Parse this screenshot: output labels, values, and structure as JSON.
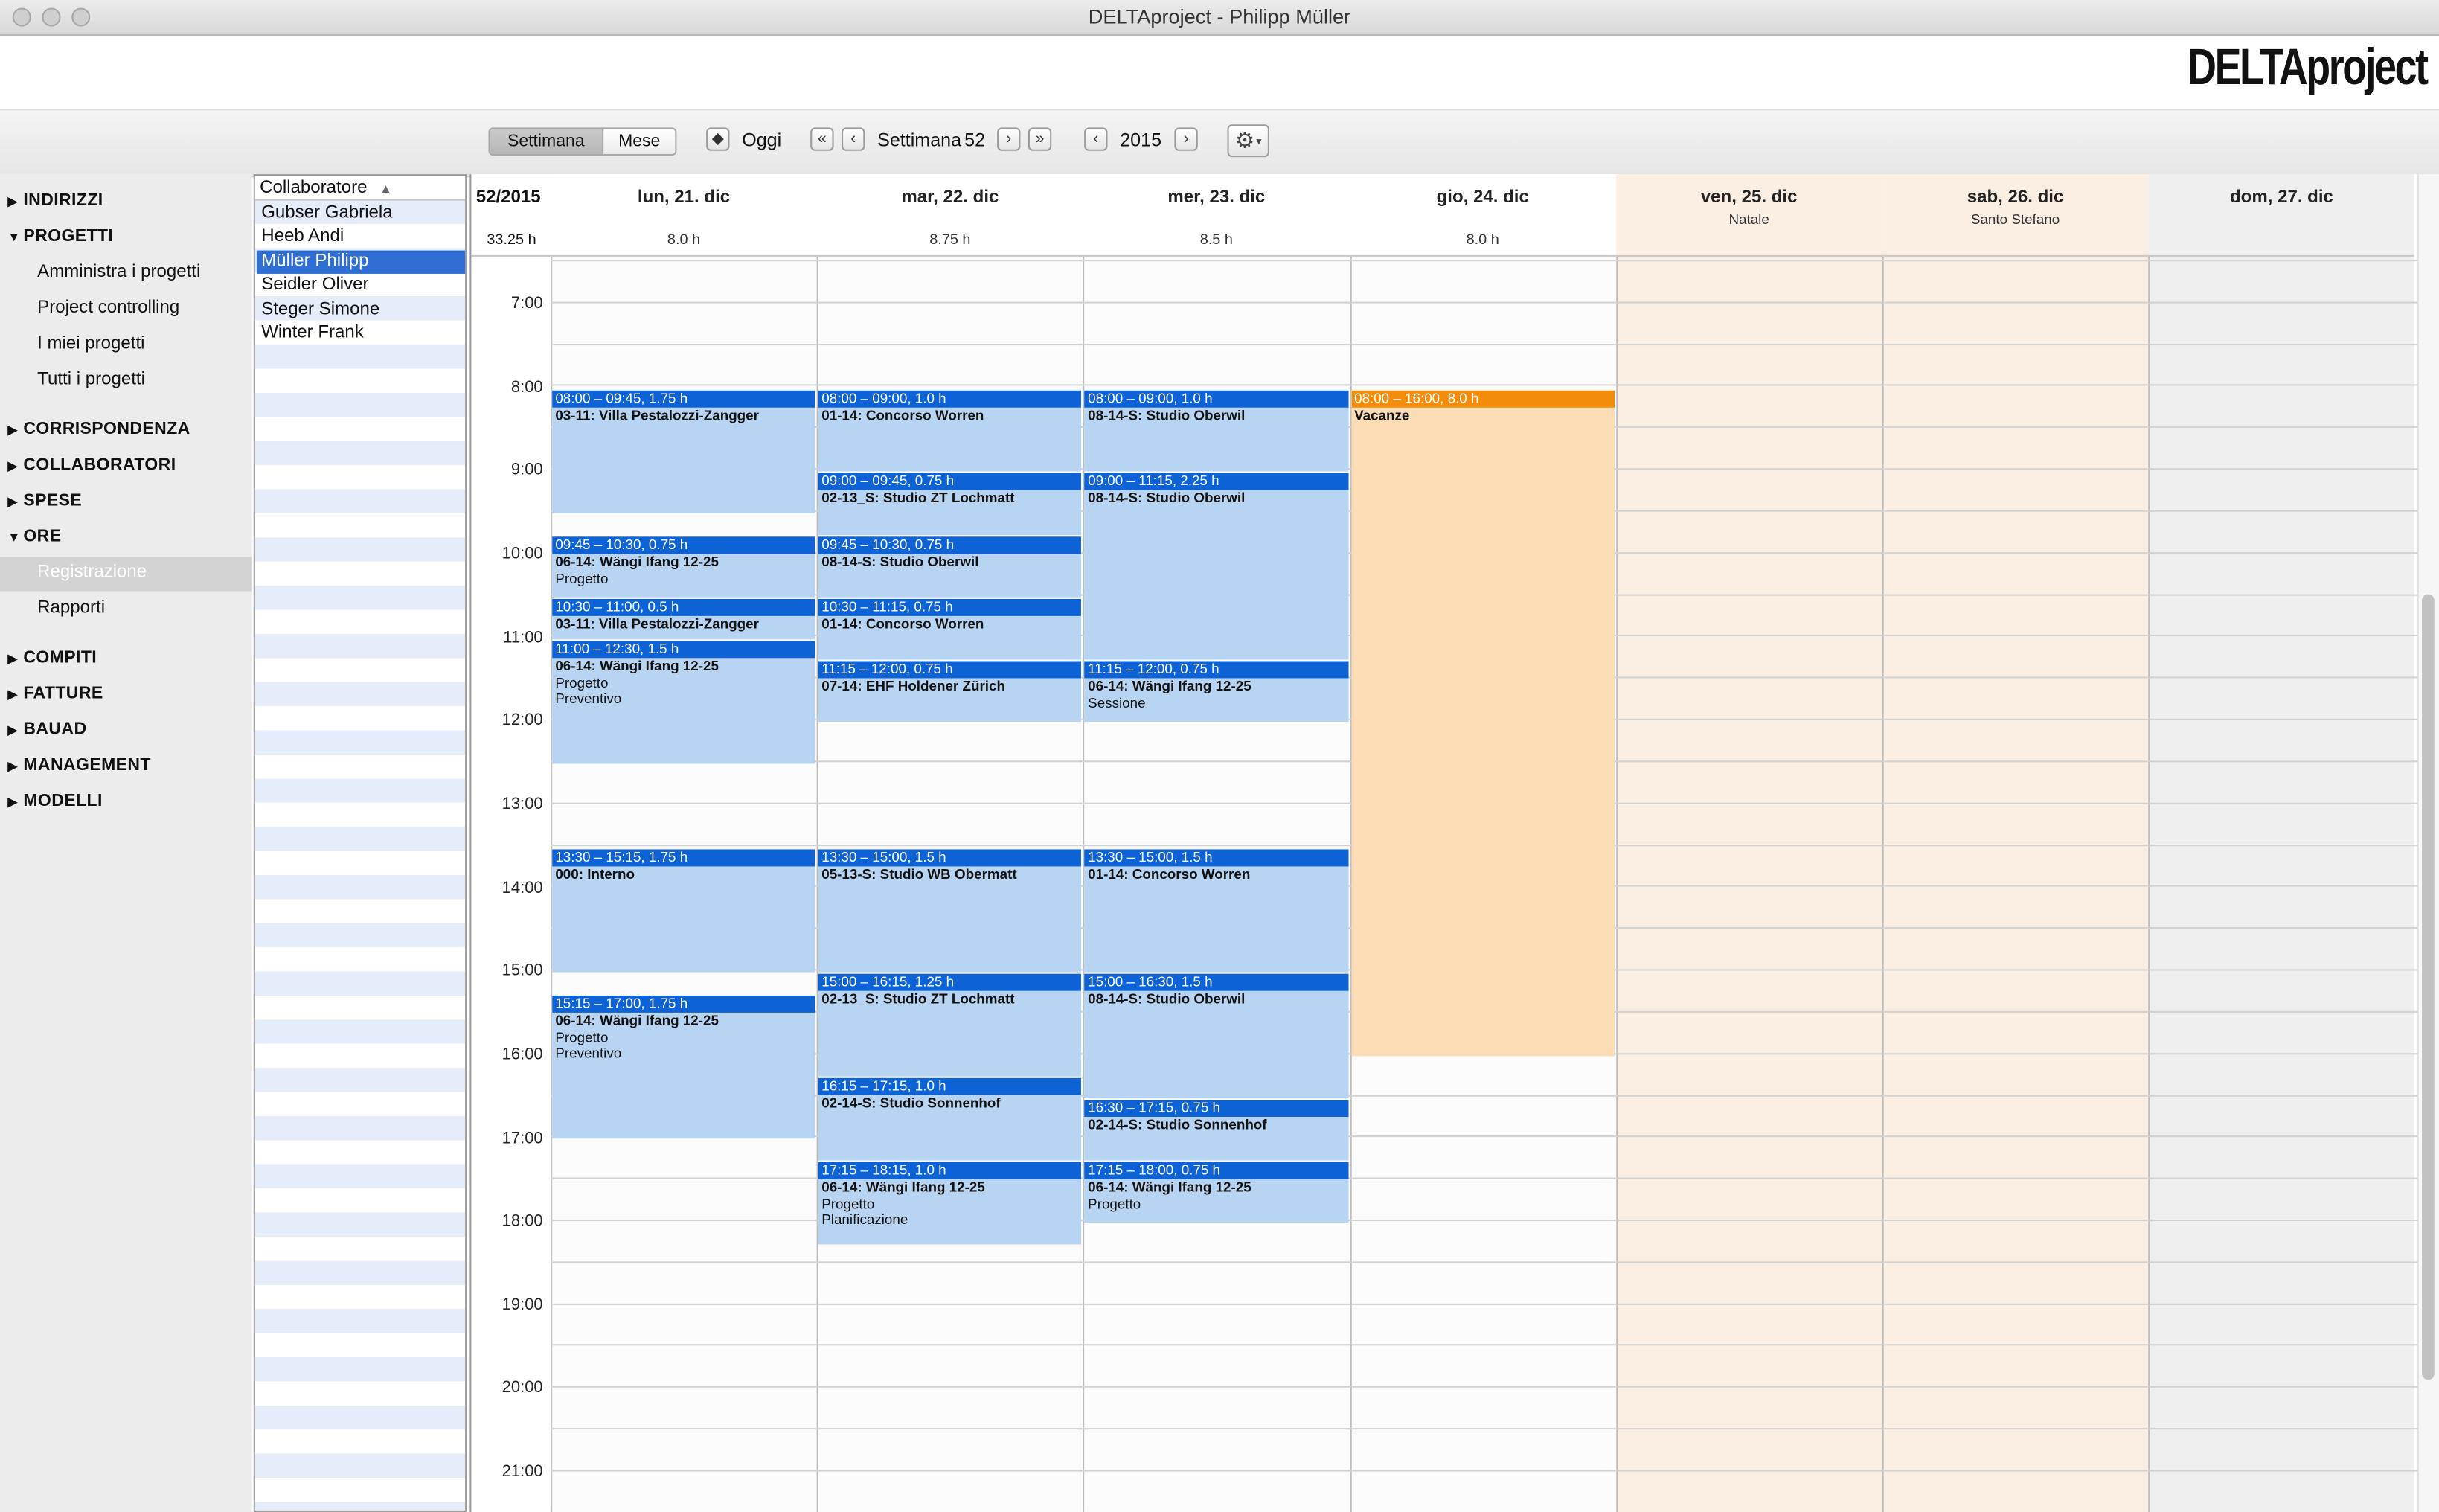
{
  "window": {
    "title": "DELTAproject - Philipp Müller"
  },
  "brand": {
    "logo": "DELTAproject"
  },
  "toolbar": {
    "view_week": "Settimana",
    "view_month": "Mese",
    "today": "Oggi",
    "week_label": "Settimana",
    "week_number": "52",
    "year": "2015"
  },
  "sidebar": {
    "sections": [
      {
        "label": "INDIRIZZI",
        "expanded": false,
        "items": []
      },
      {
        "label": "PROGETTI",
        "expanded": true,
        "items": [
          "Amministra i progetti",
          "Project controlling",
          "I miei progetti",
          "Tutti i progetti"
        ]
      },
      {
        "label": "CORRISPONDENZA",
        "expanded": false,
        "items": []
      },
      {
        "label": "COLLABORATORI",
        "expanded": false,
        "items": []
      },
      {
        "label": "SPESE",
        "expanded": false,
        "items": []
      },
      {
        "label": "ORE",
        "expanded": true,
        "items": [
          "Registrazione",
          "Rapporti"
        ],
        "selected": "Registrazione"
      },
      {
        "label": "COMPITI",
        "expanded": false,
        "items": []
      },
      {
        "label": "FATTURE",
        "expanded": false,
        "items": []
      },
      {
        "label": "BAUAD",
        "expanded": false,
        "items": []
      },
      {
        "label": "MANAGEMENT",
        "expanded": false,
        "items": []
      },
      {
        "label": "MODELLI",
        "expanded": false,
        "items": []
      }
    ]
  },
  "staff": {
    "header": "Collaboratore",
    "rows": [
      "Gubser Gabriela",
      "Heeb Andi",
      "Müller Philipp",
      "Seidler Oliver",
      "Steger Simone",
      "Winter Frank"
    ],
    "selected": "Müller Philipp"
  },
  "calendar": {
    "week_label": "52/2015",
    "week_total": "33.25 h",
    "days": [
      {
        "name": "lun, 21. dic",
        "hours": "8.0 h",
        "holiday": "",
        "weekend": false
      },
      {
        "name": "mar, 22. dic",
        "hours": "8.75 h",
        "holiday": "",
        "weekend": false
      },
      {
        "name": "mer, 23. dic",
        "hours": "8.5 h",
        "holiday": "",
        "weekend": false
      },
      {
        "name": "gio, 24. dic",
        "hours": "8.0 h",
        "holiday": "",
        "weekend": false
      },
      {
        "name": "ven, 25. dic",
        "hours": "",
        "holiday": "Natale",
        "weekend": true
      },
      {
        "name": "sab, 26. dic",
        "hours": "",
        "holiday": "Santo Stefano",
        "weekend": true
      },
      {
        "name": "dom, 27. dic",
        "hours": "",
        "holiday": "",
        "weekend": true
      }
    ],
    "hours": [
      "7:00",
      "8:00",
      "9:00",
      "10:00",
      "11:00",
      "12:00",
      "13:00",
      "14:00",
      "15:00",
      "16:00",
      "17:00",
      "18:00",
      "19:00",
      "20:00",
      "21:00"
    ],
    "colors": {
      "event": "#0d63d6",
      "event_bg": "#b8d4f3",
      "vacation": "#f38b0b",
      "vacation_bg": "#fbdcb5",
      "holiday_bg": "#fbeee2",
      "sunday_bg": "#efefef"
    },
    "events": [
      {
        "day": 0,
        "start": 8.0,
        "end": 9.5,
        "header": "08:00 – 09:45, 1.75 h",
        "title": "03-11: Villa Pestalozzi-Zangger",
        "lines": []
      },
      {
        "day": 0,
        "start": 9.75,
        "end": 10.5,
        "header": "09:45 – 10:30, 0.75 h",
        "title": "06-14: Wängi Ifang 12-25",
        "lines": [
          "Progetto"
        ]
      },
      {
        "day": 0,
        "start": 10.5,
        "end": 11.0,
        "header": "10:30 – 11:00, 0.5 h",
        "title": "03-11: Villa Pestalozzi-Zangger",
        "lines": []
      },
      {
        "day": 0,
        "start": 11.0,
        "end": 12.5,
        "header": "11:00 – 12:30, 1.5 h",
        "title": "06-14: Wängi Ifang 12-25",
        "lines": [
          "Progetto",
          "Preventivo"
        ]
      },
      {
        "day": 0,
        "start": 13.5,
        "end": 15.0,
        "header": "13:30 – 15:15, 1.75 h",
        "title": "000: Interno",
        "lines": []
      },
      {
        "day": 0,
        "start": 15.25,
        "end": 17.0,
        "header": "15:15 – 17:00, 1.75 h",
        "title": "06-14: Wängi Ifang 12-25",
        "lines": [
          "Progetto",
          "Preventivo"
        ]
      },
      {
        "day": 1,
        "start": 8.0,
        "end": 9.0,
        "header": "08:00 – 09:00, 1.0 h",
        "title": "01-14: Concorso Worren",
        "lines": []
      },
      {
        "day": 1,
        "start": 9.0,
        "end": 9.75,
        "header": "09:00 – 09:45, 0.75 h",
        "title": "02-13_S: Studio ZT Lochmatt",
        "lines": []
      },
      {
        "day": 1,
        "start": 9.75,
        "end": 10.5,
        "header": "09:45 – 10:30, 0.75 h",
        "title": "08-14-S: Studio Oberwil",
        "lines": []
      },
      {
        "day": 1,
        "start": 10.5,
        "end": 11.25,
        "header": "10:30 – 11:15, 0.75 h",
        "title": "01-14: Concorso Worren",
        "lines": []
      },
      {
        "day": 1,
        "start": 11.25,
        "end": 12.0,
        "header": "11:15 – 12:00, 0.75 h",
        "title": "07-14: EHF Holdener Zürich",
        "lines": []
      },
      {
        "day": 1,
        "start": 13.5,
        "end": 15.0,
        "header": "13:30 – 15:00, 1.5 h",
        "title": "05-13-S: Studio WB Obermatt",
        "lines": []
      },
      {
        "day": 1,
        "start": 15.0,
        "end": 16.25,
        "header": "15:00 – 16:15, 1.25 h",
        "title": "02-13_S: Studio ZT Lochmatt",
        "lines": []
      },
      {
        "day": 1,
        "start": 16.25,
        "end": 17.25,
        "header": "16:15 – 17:15, 1.0 h",
        "title": "02-14-S: Studio  Sonnenhof",
        "lines": []
      },
      {
        "day": 1,
        "start": 17.25,
        "end": 18.25,
        "header": "17:15 – 18:15, 1.0 h",
        "title": "06-14: Wängi Ifang 12-25",
        "lines": [
          "Progetto",
          "Planificazione"
        ]
      },
      {
        "day": 2,
        "start": 8.0,
        "end": 9.0,
        "header": "08:00 – 09:00, 1.0 h",
        "title": "08-14-S: Studio Oberwil",
        "lines": []
      },
      {
        "day": 2,
        "start": 9.0,
        "end": 11.25,
        "header": "09:00 – 11:15, 2.25 h",
        "title": "08-14-S: Studio Oberwil",
        "lines": []
      },
      {
        "day": 2,
        "start": 11.25,
        "end": 12.0,
        "header": "11:15 – 12:00, 0.75 h",
        "title": "06-14: Wängi Ifang 12-25",
        "lines": [
          "Sessione"
        ]
      },
      {
        "day": 2,
        "start": 13.5,
        "end": 15.0,
        "header": "13:30 – 15:00, 1.5 h",
        "title": "01-14: Concorso Worren",
        "lines": []
      },
      {
        "day": 2,
        "start": 15.0,
        "end": 16.5,
        "header": "15:00 – 16:30, 1.5 h",
        "title": "08-14-S: Studio Oberwil",
        "lines": []
      },
      {
        "day": 2,
        "start": 16.5,
        "end": 17.25,
        "header": "16:30 – 17:15, 0.75 h",
        "title": "02-14-S: Studio  Sonnenhof",
        "lines": []
      },
      {
        "day": 2,
        "start": 17.25,
        "end": 18.0,
        "header": "17:15 – 18:00, 0.75 h",
        "title": "06-14: Wängi Ifang 12-25",
        "lines": [
          "Progetto"
        ]
      },
      {
        "day": 3,
        "start": 8.0,
        "end": 16.0,
        "header": "08:00 – 16:00, 8.0 h",
        "title": "Vacanze",
        "lines": [],
        "vacation": true
      }
    ]
  }
}
